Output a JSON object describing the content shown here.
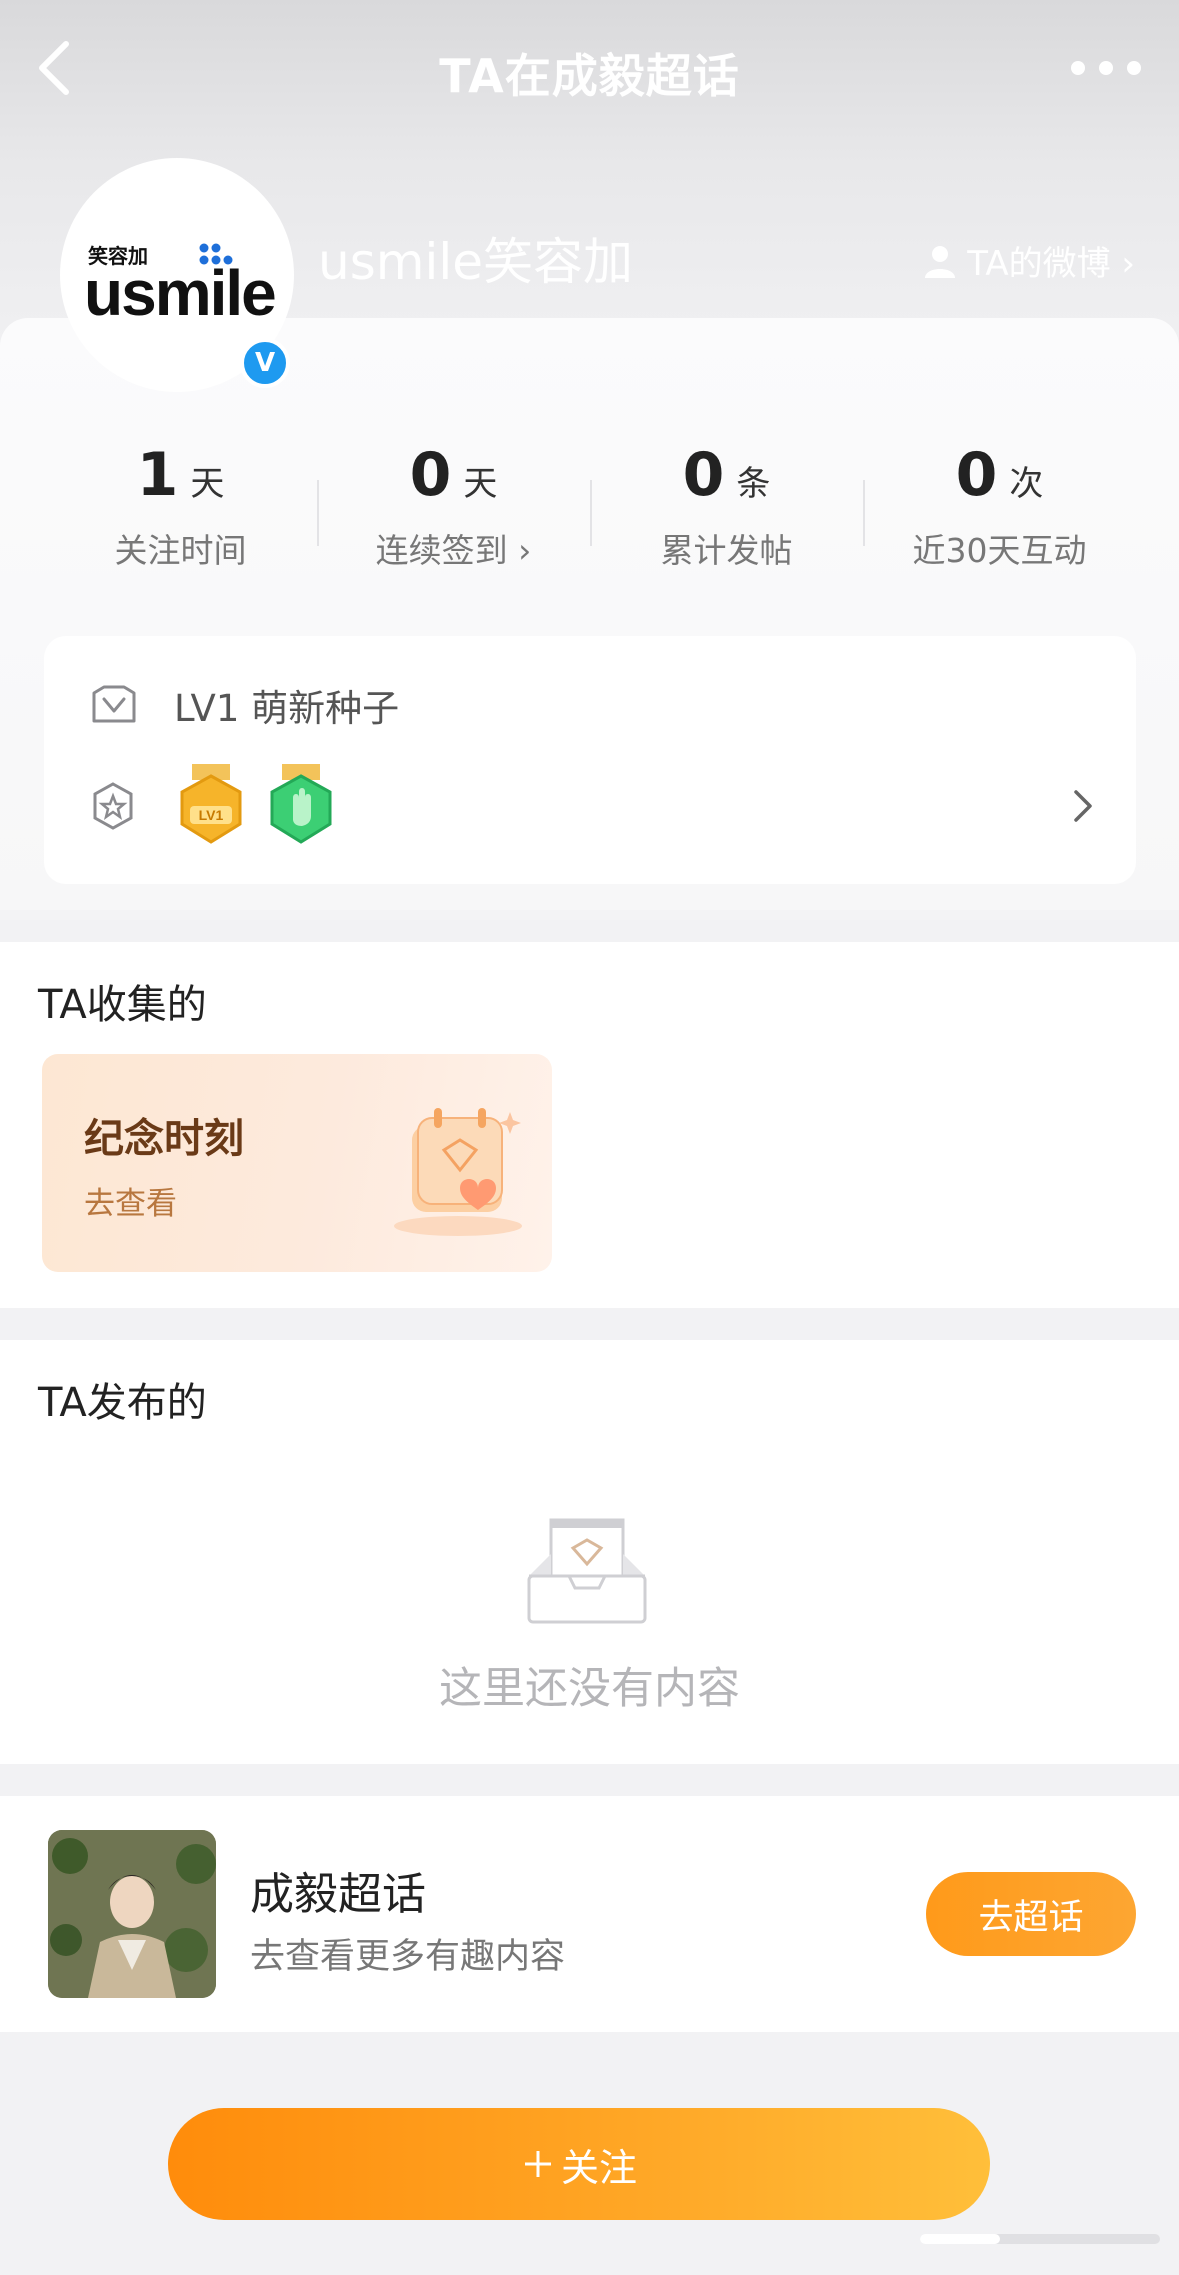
{
  "header": {
    "title": "TA在成毅超话",
    "back_icon": "chevron-left-icon",
    "more_icon": "more-dots-icon"
  },
  "profile": {
    "avatar_logo_small": "笑容加",
    "avatar_logo_main": "usmile",
    "verified_mark": "V",
    "name": "usmile笑容加",
    "weibo_link": "TA的微博 ›"
  },
  "stats": [
    {
      "value": "1",
      "unit": "天",
      "label": "关注时间"
    },
    {
      "value": "0",
      "unit": "天",
      "label": "连续签到 ›"
    },
    {
      "value": "0",
      "unit": "条",
      "label": "累计发帖"
    },
    {
      "value": "0",
      "unit": "次",
      "label": "近30天互动"
    }
  ],
  "level": {
    "text": "LV1 萌新种子",
    "medal_1_text": "LV1"
  },
  "collected": {
    "title": "TA收集的",
    "card_title": "纪念时刻",
    "card_subtitle": "去查看"
  },
  "published": {
    "title": "TA发布的",
    "empty_text": "这里还没有内容"
  },
  "topic": {
    "name": "成毅超话",
    "subtitle": "去查看更多有趣内容",
    "button": "去超话"
  },
  "follow_button": "关注",
  "colors": {
    "accent_orange": "#ff9a1a",
    "verified_blue": "#1e9af0",
    "page_bg": "#f2f2f4"
  }
}
